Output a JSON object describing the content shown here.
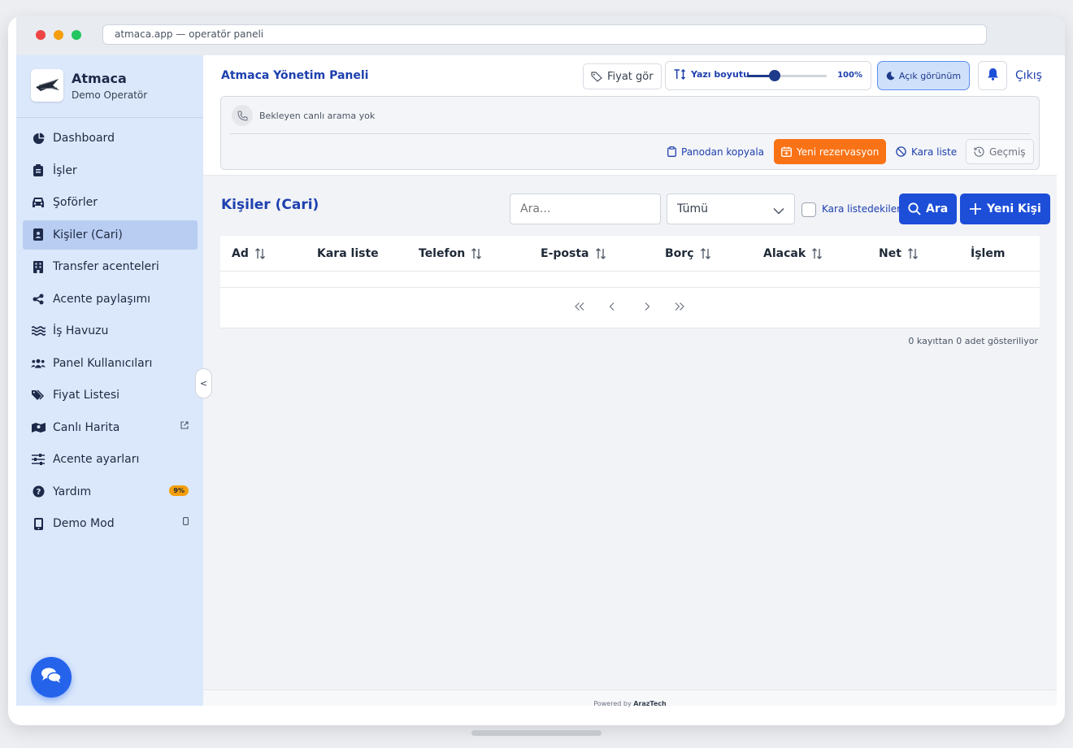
{
  "browser": {
    "url": "atmaca.app — operatör paneli"
  },
  "brand": {
    "name": "Atmaca",
    "subtitle": "Demo Operatör"
  },
  "sidebar": {
    "items": [
      {
        "label": "Dashboard",
        "icon": "pie-chart-icon"
      },
      {
        "label": "İşler",
        "icon": "clipboard-icon"
      },
      {
        "label": "Şoförler",
        "icon": "car-icon"
      },
      {
        "label": "Kişiler (Cari)",
        "icon": "address-book-icon",
        "active": true
      },
      {
        "label": "Transfer acenteleri",
        "icon": "building-icon"
      },
      {
        "label": "Acente paylaşımı",
        "icon": "share-icon"
      },
      {
        "label": "İş Havuzu",
        "icon": "water-icon"
      },
      {
        "label": "Panel Kullanıcıları",
        "icon": "users-icon"
      },
      {
        "label": "Fiyat Listesi",
        "icon": "tags-icon"
      },
      {
        "label": "Canlı Harita",
        "icon": "map-icon"
      },
      {
        "label": "Acente ayarları",
        "icon": "sliders-icon"
      },
      {
        "label": "Yardım",
        "icon": "help-icon",
        "badge": "9%"
      },
      {
        "label": "Demo Mod",
        "icon": "mobile-icon"
      }
    ],
    "collapse_label": "<"
  },
  "topbar": {
    "title": "Atmaca Yönetim Paneli",
    "price_button": "Fiyat gör",
    "font_size_label": "Yazı boyutu",
    "font_size_value": "100%",
    "font_slider_level": 0.35,
    "theme_button": "Açık görünüm",
    "logout": "Çıkış"
  },
  "call_panel": {
    "status": "Bekleyen canlı arama yok",
    "copy_button": "Panodan kopyala",
    "new_reservation": "Yeni rezervasyon",
    "blacklist": "Kara liste",
    "history": "Geçmiş"
  },
  "contacts": {
    "title": "Kişiler (Cari)",
    "search_placeholder": "Ara...",
    "filter_value": "Tümü",
    "blacklist_filter": "Kara listedekiler",
    "search_button": "Ara",
    "new_button": "Yeni Kişi",
    "columns": [
      "Ad",
      "Kara liste",
      "Telefon",
      "E-posta",
      "Borç",
      "Alacak",
      "Net",
      "İşlem"
    ],
    "rows": [],
    "records_text": "0 kayıttan 0 adet gösteriliyor"
  },
  "footer": {
    "powered_by": "Powered by",
    "company": "ArazTech"
  },
  "colors": {
    "accent": "#1d4ed8",
    "orange": "#f97316",
    "sidebar": "#dbe8fb"
  }
}
